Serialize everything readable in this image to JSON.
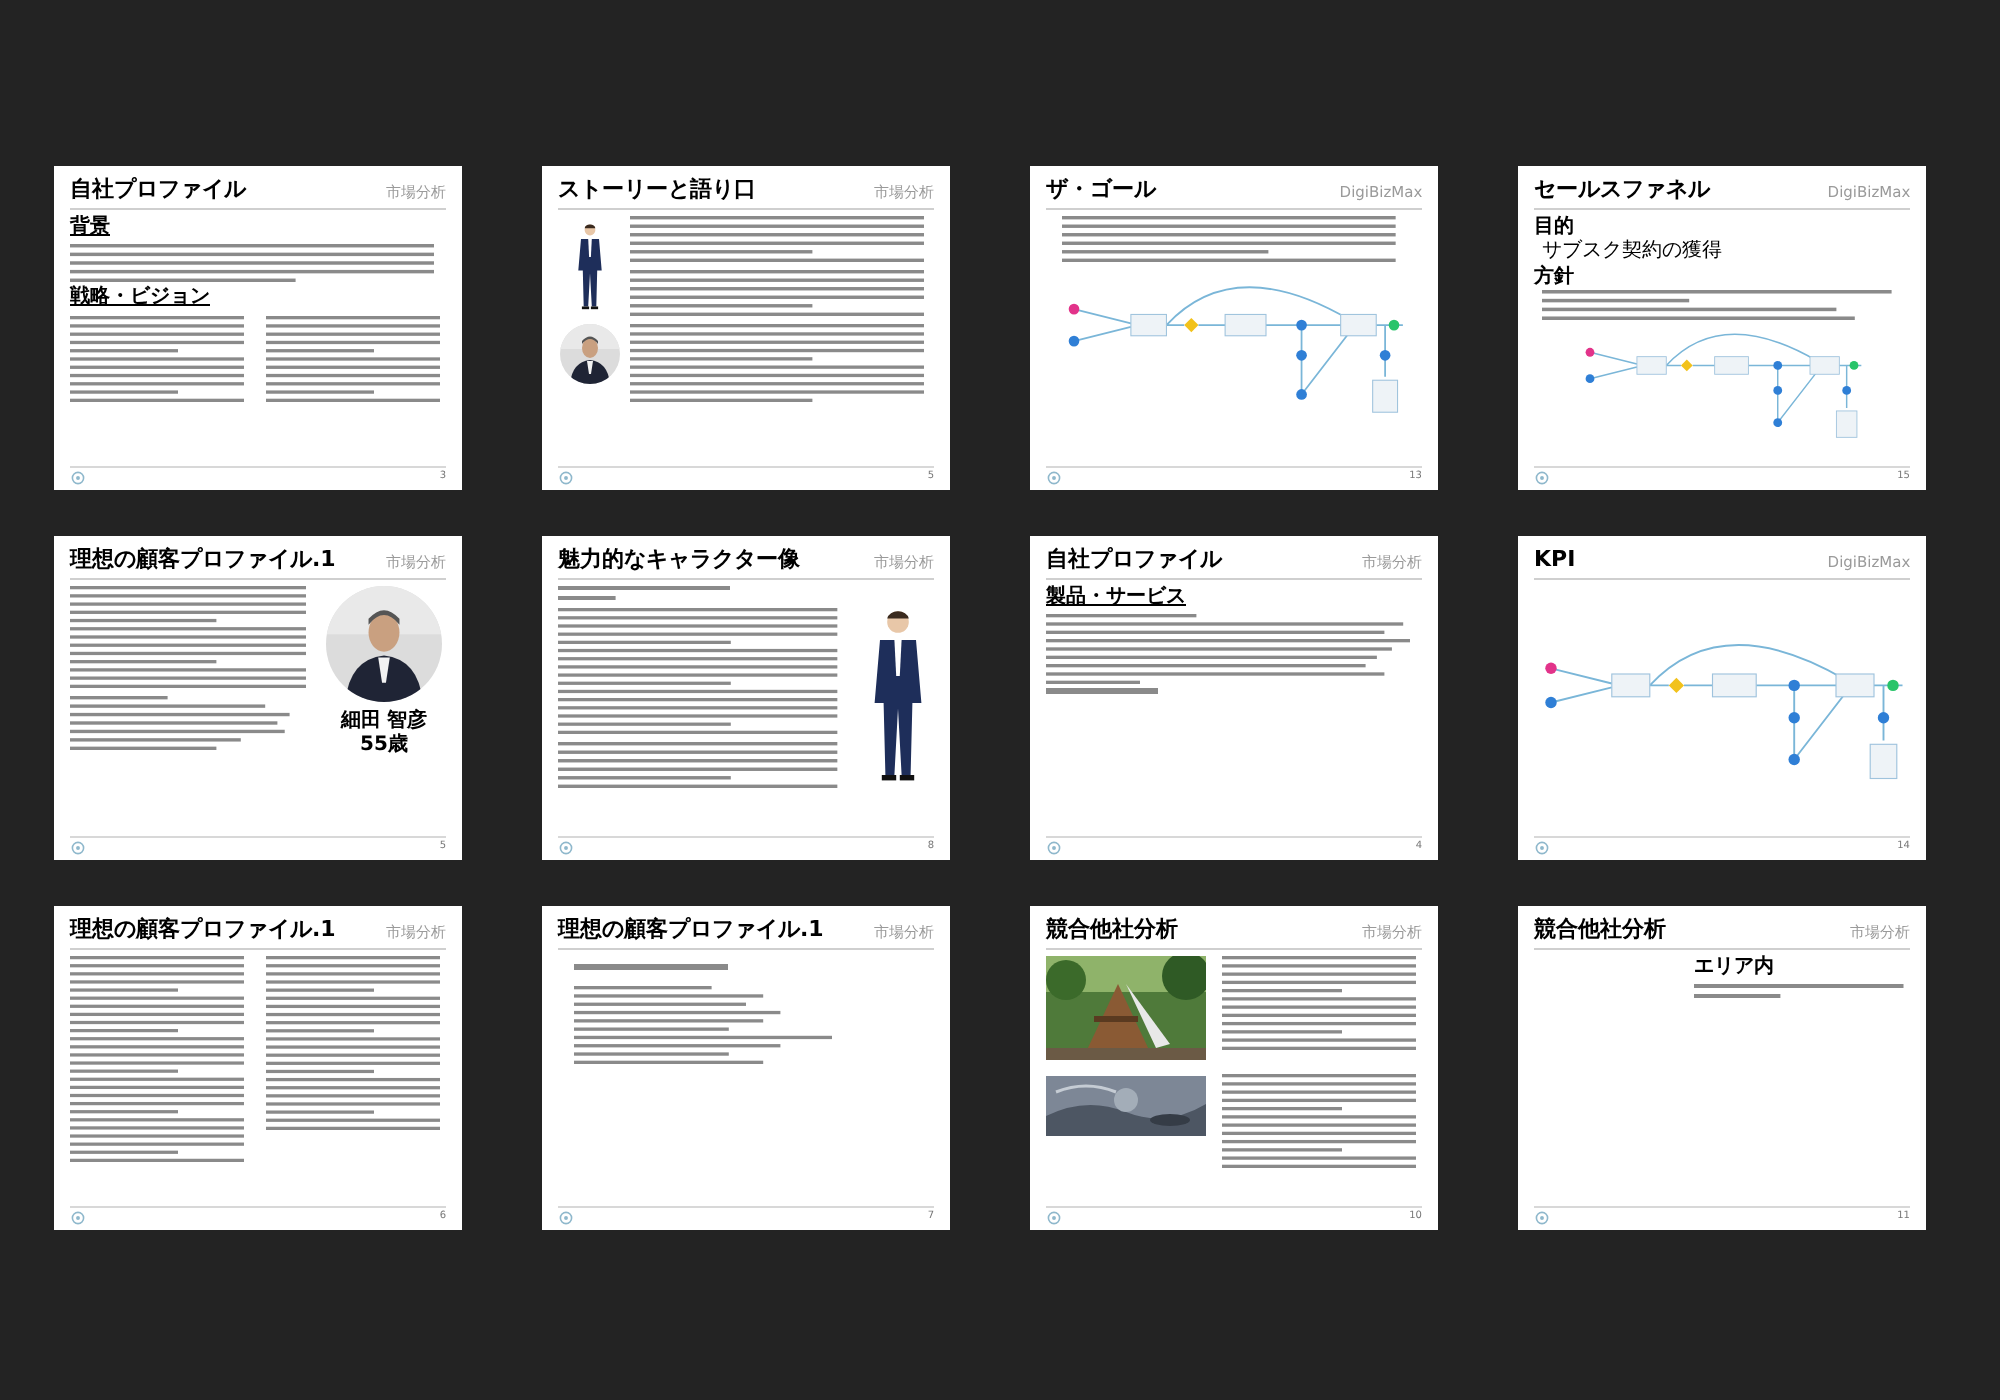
{
  "slides": [
    {
      "kind": "profile_text",
      "title": "自社プロファイル",
      "tag": "市場分析",
      "page": "3",
      "headings": [
        "背景",
        "戦略・ビジョン"
      ]
    },
    {
      "kind": "story",
      "title": "ストーリーと語り口",
      "tag": "市場分析",
      "page": "5"
    },
    {
      "kind": "goal",
      "title": "ザ・ゴール",
      "tag": "DigiBizMax",
      "page": "13"
    },
    {
      "kind": "funnel",
      "title": "セールスファネル",
      "tag": "DigiBizMax",
      "page": "15",
      "headings": [
        "目的",
        "サブスク契約の獲得",
        "方針"
      ]
    },
    {
      "kind": "customer",
      "title": "理想の顧客プロファイル.1",
      "tag": "市場分析",
      "page": "5",
      "person_name": "細田 智彦",
      "age": "55歳"
    },
    {
      "kind": "character",
      "title": "魅力的なキャラクター像",
      "tag": "市場分析",
      "page": "8"
    },
    {
      "kind": "product",
      "title": "自社プロファイル",
      "tag": "市場分析",
      "page": "4",
      "headings": [
        "製品・サービス"
      ]
    },
    {
      "kind": "kpi",
      "title": "KPI",
      "tag": "DigiBizMax",
      "page": "14"
    },
    {
      "kind": "columns",
      "title": "理想の顧客プロファイル.1",
      "tag": "市場分析",
      "page": "6"
    },
    {
      "kind": "questions",
      "title": "理想の顧客プロファイル.1",
      "tag": "市場分析",
      "page": "7"
    },
    {
      "kind": "competitor",
      "title": "競合他社分析",
      "tag": "市場分析",
      "page": "10"
    },
    {
      "kind": "area",
      "title": "競合他社分析",
      "tag": "市場分析",
      "page": "11",
      "headings": [
        "エリア内"
      ]
    }
  ]
}
